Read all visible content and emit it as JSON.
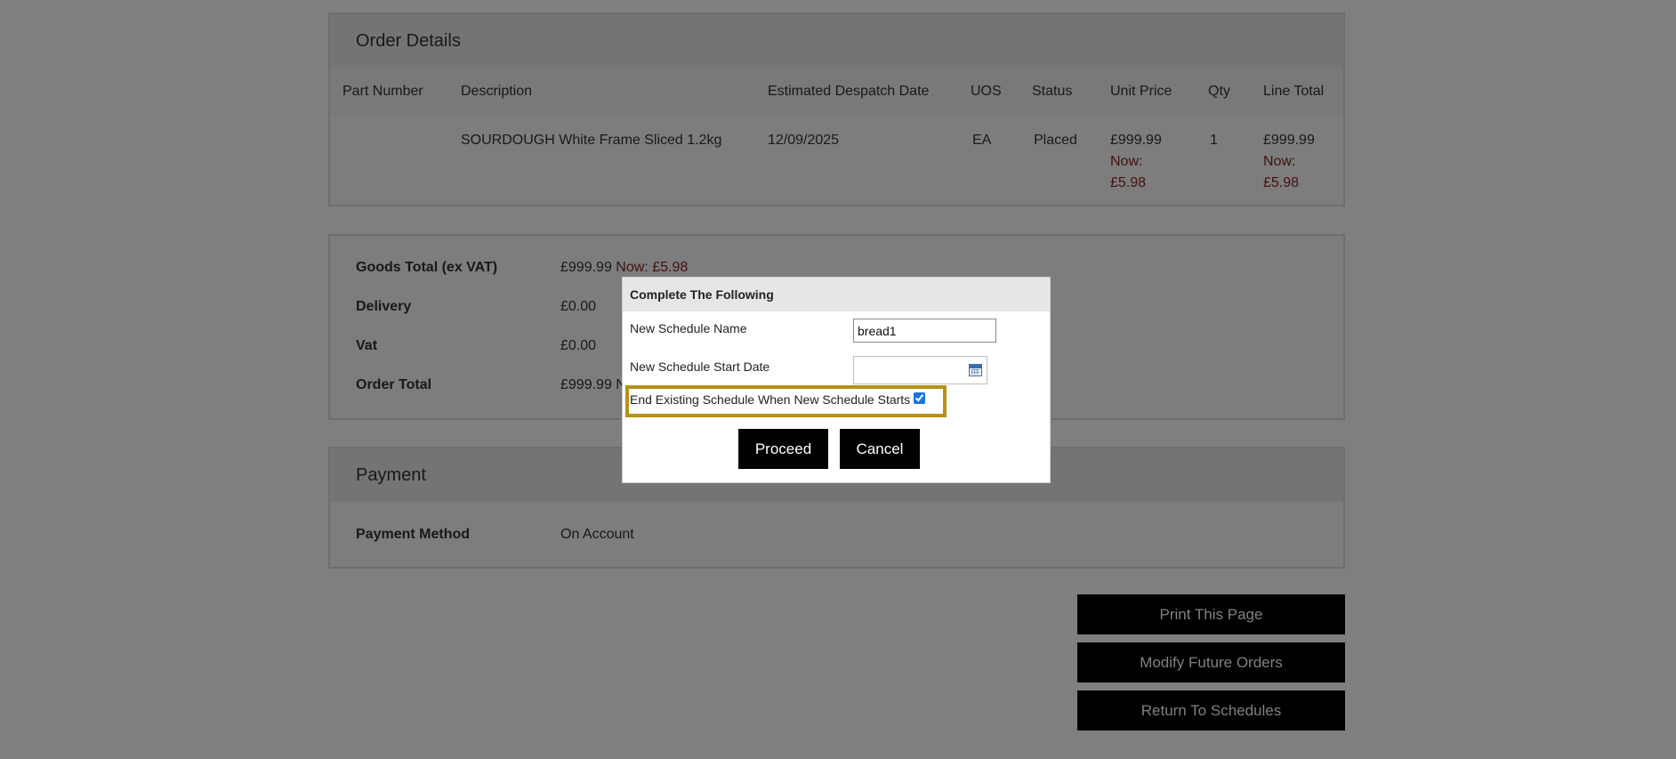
{
  "order_details": {
    "title": "Order Details",
    "columns": [
      "Part Number",
      "Description",
      "Estimated Despatch Date",
      "UOS",
      "Status",
      "Unit Price",
      "Qty",
      "Line Total"
    ],
    "row": {
      "part_number": "",
      "description": "SOURDOUGH White Frame Sliced 1.2kg",
      "despatch_date": "12/09/2025",
      "uos": "EA",
      "status": "Placed",
      "unit_price": "£999.99",
      "unit_price_now_label": "Now:",
      "unit_price_now": "£5.98",
      "qty": "1",
      "line_total": "£999.99",
      "line_total_now_label": "Now:",
      "line_total_now": "£5.98"
    }
  },
  "totals": {
    "goods_label": "Goods Total (ex VAT)",
    "goods_value": "£999.99",
    "goods_now": "Now: £5.98",
    "delivery_label": "Delivery",
    "delivery_value": "£0.00",
    "vat_label": "Vat",
    "vat_value": "£0.00",
    "order_total_label": "Order Total",
    "order_total_value": "£999.99 N"
  },
  "payment": {
    "title": "Payment",
    "method_label": "Payment Method",
    "method_value": "On Account"
  },
  "actions": {
    "print": "Print This Page",
    "modify": "Modify Future Orders",
    "return": "Return To Schedules"
  },
  "modal": {
    "title": "Complete The Following",
    "name_label": "New Schedule Name",
    "name_value": "bread1",
    "start_date_label": "New Schedule Start Date",
    "start_date_value": "",
    "end_existing_label": "End Existing Schedule When New Schedule Starts",
    "end_existing_checked": true,
    "proceed": "Proceed",
    "cancel": "Cancel"
  },
  "colors": {
    "now_price": "#8b1e1e",
    "highlight_border": "#b59214",
    "button_bg": "#000000"
  }
}
